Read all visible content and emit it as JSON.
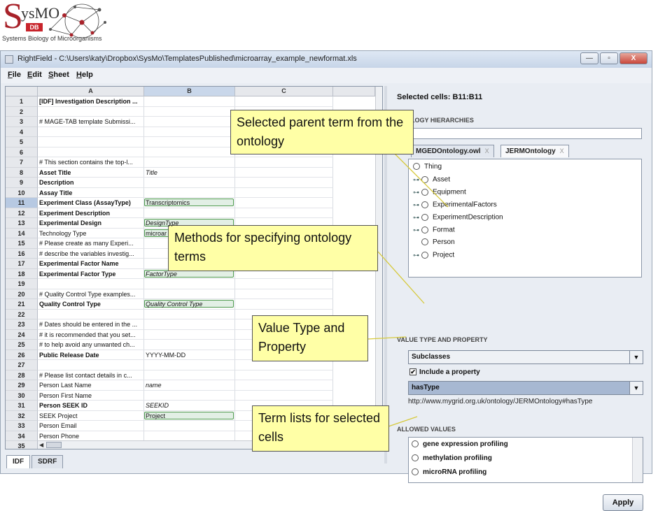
{
  "logo": {
    "big_letter": "S",
    "name": "ysMO",
    "badge": "DB",
    "tagline": "Systems Biology of Microorganisms"
  },
  "window": {
    "title": "RightField - C:\\Users\\katy\\Dropbox\\SysMo\\TemplatesPublished\\microarray_example_newformat.xls",
    "buttons": {
      "minimize": "—",
      "maximize": "▫",
      "close": "X"
    }
  },
  "menu": [
    "File",
    "Edit",
    "Sheet",
    "Help"
  ],
  "sheet": {
    "columns": [
      "A",
      "B",
      "C"
    ],
    "rows": [
      {
        "n": "1",
        "a": "[IDF] Investigation Description ...",
        "b": "",
        "bold": true
      },
      {
        "n": "2",
        "a": "",
        "b": ""
      },
      {
        "n": "3",
        "a": "# MAGE-TAB template Submissi...",
        "b": ""
      },
      {
        "n": "4",
        "a": "",
        "b": ""
      },
      {
        "n": "5",
        "a": "",
        "b": ""
      },
      {
        "n": "6",
        "a": "",
        "b": ""
      },
      {
        "n": "7",
        "a": "# This section contains the top-l...",
        "b": ""
      },
      {
        "n": "8",
        "a": "Asset Title",
        "b": "Title",
        "bold": true,
        "italic": true
      },
      {
        "n": "9",
        "a": "Description",
        "b": "",
        "bold": true
      },
      {
        "n": "10",
        "a": "Assay Title",
        "b": "",
        "bold": true
      },
      {
        "n": "11",
        "a": "Experiment Class (AssayType)",
        "b": "Transcriptomics",
        "bold": true,
        "green": true,
        "selected": true
      },
      {
        "n": "12",
        "a": "Experiment Description",
        "b": "",
        "bold": true
      },
      {
        "n": "13",
        "a": "Experimental Design",
        "b": "DesignType",
        "bold": true,
        "green": true,
        "italic": true
      },
      {
        "n": "14",
        "a": "Technology Type",
        "b": "microar",
        "green": true
      },
      {
        "n": "15",
        "a": "# Please create as many Experi...",
        "b": ""
      },
      {
        "n": "16",
        "a": "# describe the variables investig...",
        "b": ""
      },
      {
        "n": "17",
        "a": "Experimental Factor Name",
        "b": "",
        "bold": true
      },
      {
        "n": "18",
        "a": "Experimental Factor Type",
        "b": "FactorType",
        "bold": true,
        "green": true,
        "italic": true
      },
      {
        "n": "19",
        "a": "",
        "b": ""
      },
      {
        "n": "20",
        "a": "# Quality Control Type examples...",
        "b": ""
      },
      {
        "n": "21",
        "a": "Quality Control Type",
        "b": "Quality Control Type",
        "bold": true,
        "green": true,
        "italic": true
      },
      {
        "n": "22",
        "a": "",
        "b": ""
      },
      {
        "n": "23",
        "a": "# Dates should be entered in the ...",
        "b": ""
      },
      {
        "n": "24",
        "a": "# it is recommended that you set...",
        "b": ""
      },
      {
        "n": "25",
        "a": "# to help avoid any unwanted ch...",
        "b": ""
      },
      {
        "n": "26",
        "a": "Public Release Date",
        "b": "YYYY-MM-DD",
        "bold": true
      },
      {
        "n": "27",
        "a": "",
        "b": ""
      },
      {
        "n": "28",
        "a": "# Please list contact details in c...",
        "b": ""
      },
      {
        "n": "29",
        "a": "Person Last Name",
        "b": "name",
        "italic": true
      },
      {
        "n": "30",
        "a": "Person First Name",
        "b": ""
      },
      {
        "n": "31",
        "a": "Person SEEK ID",
        "b": "SEEKID",
        "bold": true,
        "italic": true
      },
      {
        "n": "32",
        "a": "SEEK Project",
        "b": "Project",
        "green": true
      },
      {
        "n": "33",
        "a": "Person Email",
        "b": ""
      },
      {
        "n": "34",
        "a": "Person Phone",
        "b": ""
      },
      {
        "n": "35",
        "a": "",
        "b": ""
      }
    ],
    "tabs": [
      "IDF",
      "SDRF"
    ]
  },
  "right_panel": {
    "selected_cells": "Selected cells: B11:B11",
    "hierarchies_label": "LOGY HIERARCHIES",
    "ontology_tabs": [
      {
        "label": "MGEDOntology.owl",
        "close": "X"
      },
      {
        "label": "JERMOntology",
        "close": "X"
      }
    ],
    "tree": {
      "root": "Thing",
      "children": [
        "Asset",
        "Equipment",
        "ExperimentalFactors",
        "ExperimentDescription",
        "Format",
        "Person",
        "Project"
      ]
    },
    "value_type_label": "VALUE TYPE AND PROPERTY",
    "value_type": "Subclasses",
    "include_property_label": "Include a property",
    "property": "hasType",
    "property_uri": "http://www.mygrid.org.uk/ontology/JERMOntology#hasType",
    "allowed_label": "ALLOWED VALUES",
    "allowed_values": [
      "gene expression profiling",
      "methylation profiling",
      "microRNA profiling"
    ],
    "apply_label": "Apply"
  },
  "callouts": {
    "parent_term": "Selected parent term from the ontology",
    "methods": "Methods for specifying ontology terms",
    "value_type": "Value Type and Property",
    "term_lists": "Term lists for selected cells"
  }
}
